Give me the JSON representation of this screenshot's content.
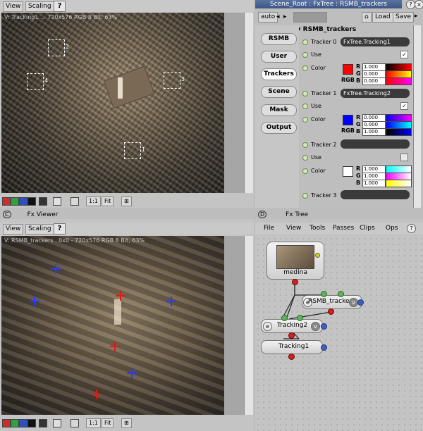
{
  "top_viewer": {
    "menu": {
      "view": "View",
      "scaling": "Scaling",
      "help": "?"
    },
    "overlay_text": "V: Tracking1 ... 720x576 RGB 8 Bit, 63%",
    "tracker_labels": [
      "2",
      "4",
      "3",
      "1"
    ],
    "status": {
      "one_to_one": "1:1",
      "fit": "Fit"
    }
  },
  "bottom_viewer": {
    "title": "Fx Viewer",
    "menu": {
      "view": "View",
      "scaling": "Scaling",
      "help": "?"
    },
    "overlay_text": "V: RSMB_trackers . 0x0 - 720x576 RGB 8 Bit, 63%",
    "status": {
      "one_to_one": "1:1",
      "fit": "Fit"
    }
  },
  "property_editor": {
    "window_title": "Scene_Root : FxTree : RSMB_trackers",
    "toolbar": {
      "auto": "auto",
      "load": "Load",
      "save": "Save"
    },
    "section_title": "RSMB_trackers",
    "tabs": [
      "RSMB",
      "User",
      "Trackers",
      "Scene",
      "Mask",
      "Output"
    ],
    "active_tab": "Trackers",
    "trackers": [
      {
        "label": "Tracker 0",
        "value": "FxTree.Tracking1",
        "use_label": "Use",
        "use_checked": true,
        "color_label": "Color",
        "color": "#ff0000",
        "r": "1.000",
        "g": "0.000",
        "b": "0.000"
      },
      {
        "label": "Tracker 1",
        "value": "FxTree.Tracking2",
        "use_label": "Use",
        "use_checked": true,
        "color_label": "Color",
        "color": "#0000ff",
        "r": "0.000",
        "g": "0.000",
        "b": "1.000"
      },
      {
        "label": "Tracker 2",
        "value": "",
        "use_label": "Use",
        "use_checked": false,
        "color_label": "Color",
        "color": "#ffffff",
        "r": "1.000",
        "g": "1.000",
        "b": "1.000"
      },
      {
        "label": "Tracker 3",
        "value": ""
      }
    ],
    "rgb_letters": {
      "r": "R",
      "g": "G",
      "b": "B",
      "rgb": "RGB"
    }
  },
  "fx_tree": {
    "title": "Fx Tree",
    "menu": [
      "File",
      "View",
      "Tools",
      "Passes",
      "Clips",
      "Ops"
    ],
    "nodes": {
      "medina": "medina",
      "rsmb": "RSMB_trackers",
      "tracking2": "Tracking2",
      "tracking1": "Tracking1"
    },
    "node_badges": {
      "v": "v",
      "e": "e"
    }
  }
}
